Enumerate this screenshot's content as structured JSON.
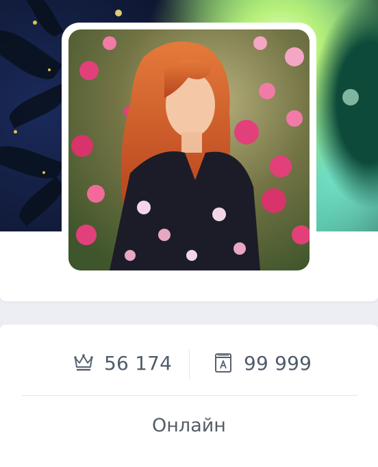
{
  "profile": {
    "cover_image": "green-fantasy-forest-cover",
    "avatar_image": "red-haired-woman-with-hollyhock-flowers"
  },
  "stats": {
    "rating": {
      "icon": "crown-icon",
      "value": "56 174"
    },
    "books": {
      "icon": "book-icon",
      "value": "99 999"
    }
  },
  "status": {
    "label": "Онлайн"
  },
  "colors": {
    "page_background": "#eceef4",
    "card_background": "#ffffff",
    "text_muted": "#4f5b6a",
    "divider": "#e1e5ea"
  }
}
